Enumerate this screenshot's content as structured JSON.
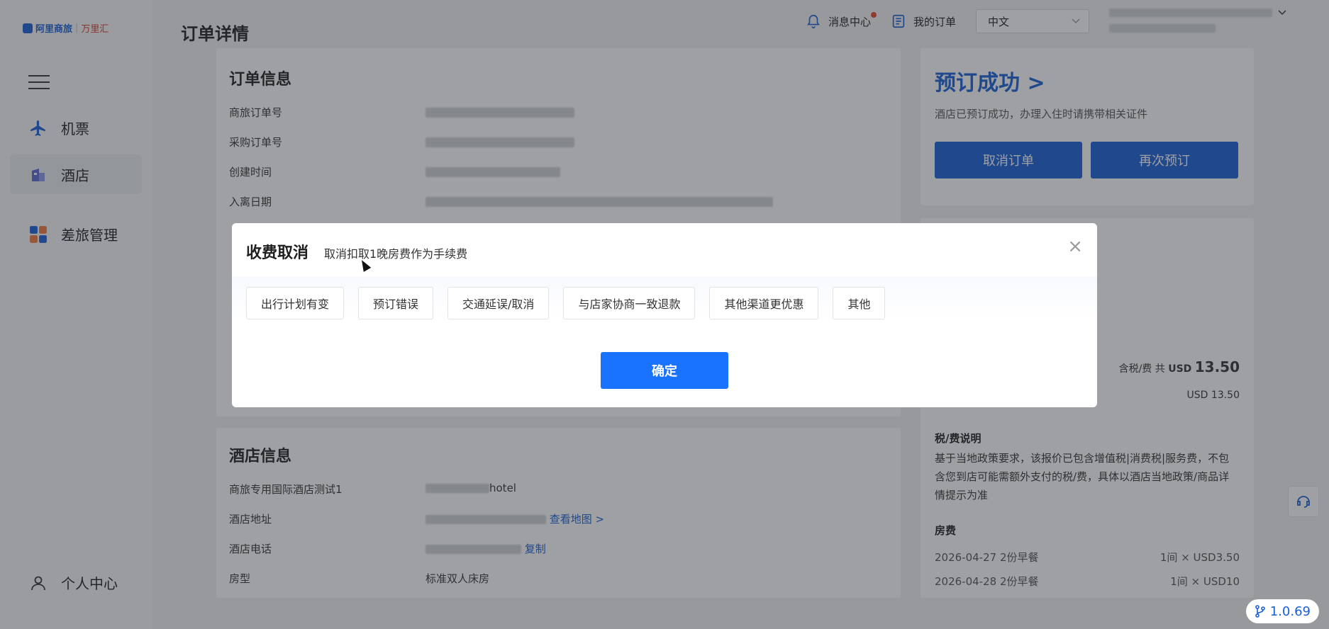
{
  "brand": {
    "name_a": "阿里商旅",
    "name_b": "万里汇"
  },
  "sidebar": {
    "items": [
      {
        "label": "机票",
        "icon": "plane-icon"
      },
      {
        "label": "酒店",
        "icon": "hotel-icon"
      },
      {
        "label": "差旅管理",
        "icon": "grid-icon"
      },
      {
        "label": "个人中心",
        "icon": "user-icon"
      }
    ]
  },
  "header": {
    "title": "订单详情",
    "messages": "消息中心",
    "orders": "我的订单",
    "language": "中文"
  },
  "order_info": {
    "title": "订单信息",
    "labels": [
      "商旅订单号",
      "采购订单号",
      "创建时间",
      "入离日期"
    ]
  },
  "hotel_info": {
    "title": "酒店信息",
    "name_label": "商旅专用国际酒店测试1",
    "name_value_suffix": "hotel",
    "address_label": "酒店地址",
    "map_link": "查看地图 >",
    "phone_label": "酒店电话",
    "copy_link": "复制",
    "room_label": "房型",
    "room_value": "标准双人床房"
  },
  "status_panel": {
    "title": "预订成功 >",
    "desc": "酒店已预订成功，办理入住时请携带相关证件",
    "cancel": "取消订单",
    "rebook": "再次预订"
  },
  "price_panel": {
    "total_prefix": "含税/费 共",
    "total_currency": "USD",
    "total_amount": "13.50",
    "subtotal": "USD 13.50",
    "tax_title": "税/费说明",
    "tax_text": "基于当地政策要求，该报价已包含增值税|消费税|服务费，不包含您到店可能需额外支付的税/费，具体以酒店当地政策/商品详情提示为准",
    "room_fee_title": "房费",
    "nights": [
      {
        "date": "2026-04-27 2份早餐",
        "price": "1间 × USD3.50"
      },
      {
        "date": "2026-04-28 2份早餐",
        "price": "1间 × USD10"
      }
    ]
  },
  "dialog": {
    "title": "收费取消",
    "subtitle": "取消扣取1晚房费作为手续费",
    "reasons": [
      "出行计划有变",
      "预订错误",
      "交通延误/取消",
      "与店家协商一致退款",
      "其他渠道更优惠",
      "其他"
    ],
    "confirm": "确定"
  },
  "version": "1.0.69",
  "colors": {
    "primary": "#1a5fd6",
    "confirm": "#1a73ff",
    "alert": "#e8452e"
  }
}
